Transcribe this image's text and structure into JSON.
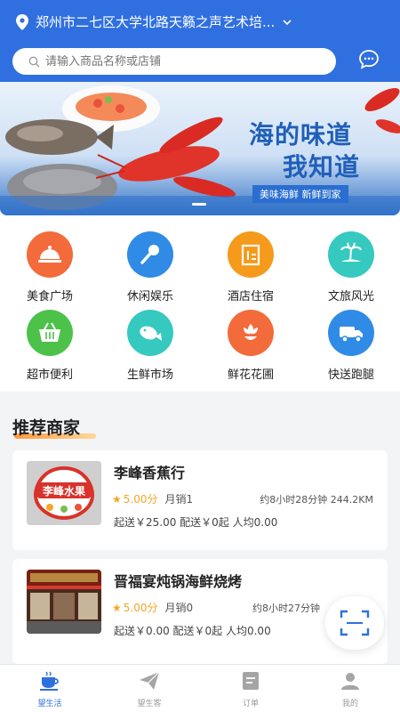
{
  "header": {
    "location": "郑州市二七区大学北路天籁之声艺术培...",
    "search_placeholder": "请输入商品名称或店铺"
  },
  "banner": {
    "slogan_line1": "海的味道",
    "slogan_line2": "我知道",
    "tagline": "美味海鲜  新鲜到家"
  },
  "categories": [
    {
      "label": "美食广场",
      "icon": "dining-cloche-icon",
      "color": "#f36b3b"
    },
    {
      "label": "休闲娱乐",
      "icon": "microphone-icon",
      "color": "#2f8be6"
    },
    {
      "label": "酒店住宿",
      "icon": "hotel-building-icon",
      "color": "#f59a1b"
    },
    {
      "label": "文旅风光",
      "icon": "island-palm-icon",
      "color": "#36c9c0"
    },
    {
      "label": "超市便利",
      "icon": "shopping-basket-icon",
      "color": "#4cc24a"
    },
    {
      "label": "生鲜市场",
      "icon": "fish-icon",
      "color": "#36c9c0"
    },
    {
      "label": "鲜花花圃",
      "icon": "flower-icon",
      "color": "#f36b3b"
    },
    {
      "label": "快送跑腿",
      "icon": "delivery-truck-icon",
      "color": "#2f8be6"
    }
  ],
  "section_title": "推荐商家",
  "merchants": [
    {
      "name": "李峰香蕉行",
      "score": "5.00分",
      "sales": "月销1",
      "distance": "约8小时28分钟 244.2KM",
      "fees": "起送￥25.00  配送￥0起  人均0.00",
      "logo_text": "李峰水果"
    },
    {
      "name": "晋福宴炖锅海鲜烧烤",
      "score": "5.00分",
      "sales": "月销0",
      "distance": "约8小时27分钟",
      "fees": "起送￥0.00  配送￥0起  人均0.00"
    }
  ],
  "tabbar": [
    {
      "label": "望生活",
      "icon": "coffee-cup-icon",
      "active": true
    },
    {
      "label": "望生客",
      "icon": "paper-plane-icon",
      "active": false
    },
    {
      "label": "订单",
      "icon": "order-list-icon",
      "active": false
    },
    {
      "label": "我的",
      "icon": "user-icon",
      "active": false
    }
  ],
  "colors": {
    "brand": "#2f6fe0",
    "star": "#f5a623"
  }
}
